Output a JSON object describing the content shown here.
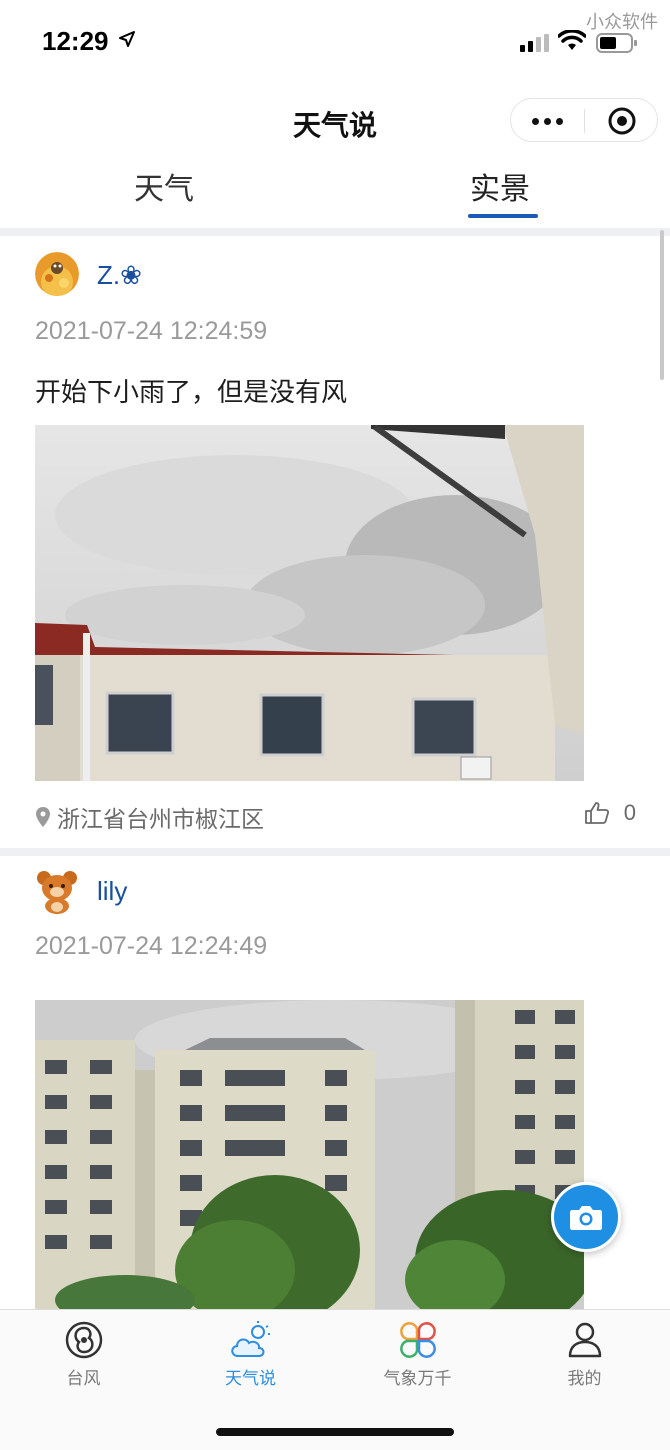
{
  "status_bar": {
    "time": "12:29",
    "watermark": "小众软件"
  },
  "nav": {
    "title": "天气说"
  },
  "tabs": [
    {
      "label": "天气",
      "active": false
    },
    {
      "label": "实景",
      "active": true
    }
  ],
  "posts": [
    {
      "username": "Z.❀",
      "timestamp": "2021-07-24 12:24:59",
      "content": "开始下小雨了，但是没有风",
      "location": "浙江省台州市椒江区",
      "likes": "0"
    },
    {
      "username": "lily",
      "timestamp": "2021-07-24 12:24:49",
      "content": ""
    }
  ],
  "tab_bar": [
    {
      "label": "台风",
      "icon": "typhoon-icon",
      "active": false
    },
    {
      "label": "天气说",
      "icon": "cloud-sun-icon",
      "active": true
    },
    {
      "label": "气象万千",
      "icon": "clover-icon",
      "active": false
    },
    {
      "label": "我的",
      "icon": "user-icon",
      "active": false
    }
  ],
  "colors": {
    "accent": "#1a5bb5",
    "username": "#1a4fa0",
    "active_tab": "#2b8ee0",
    "fab": "#1e8fe3"
  }
}
